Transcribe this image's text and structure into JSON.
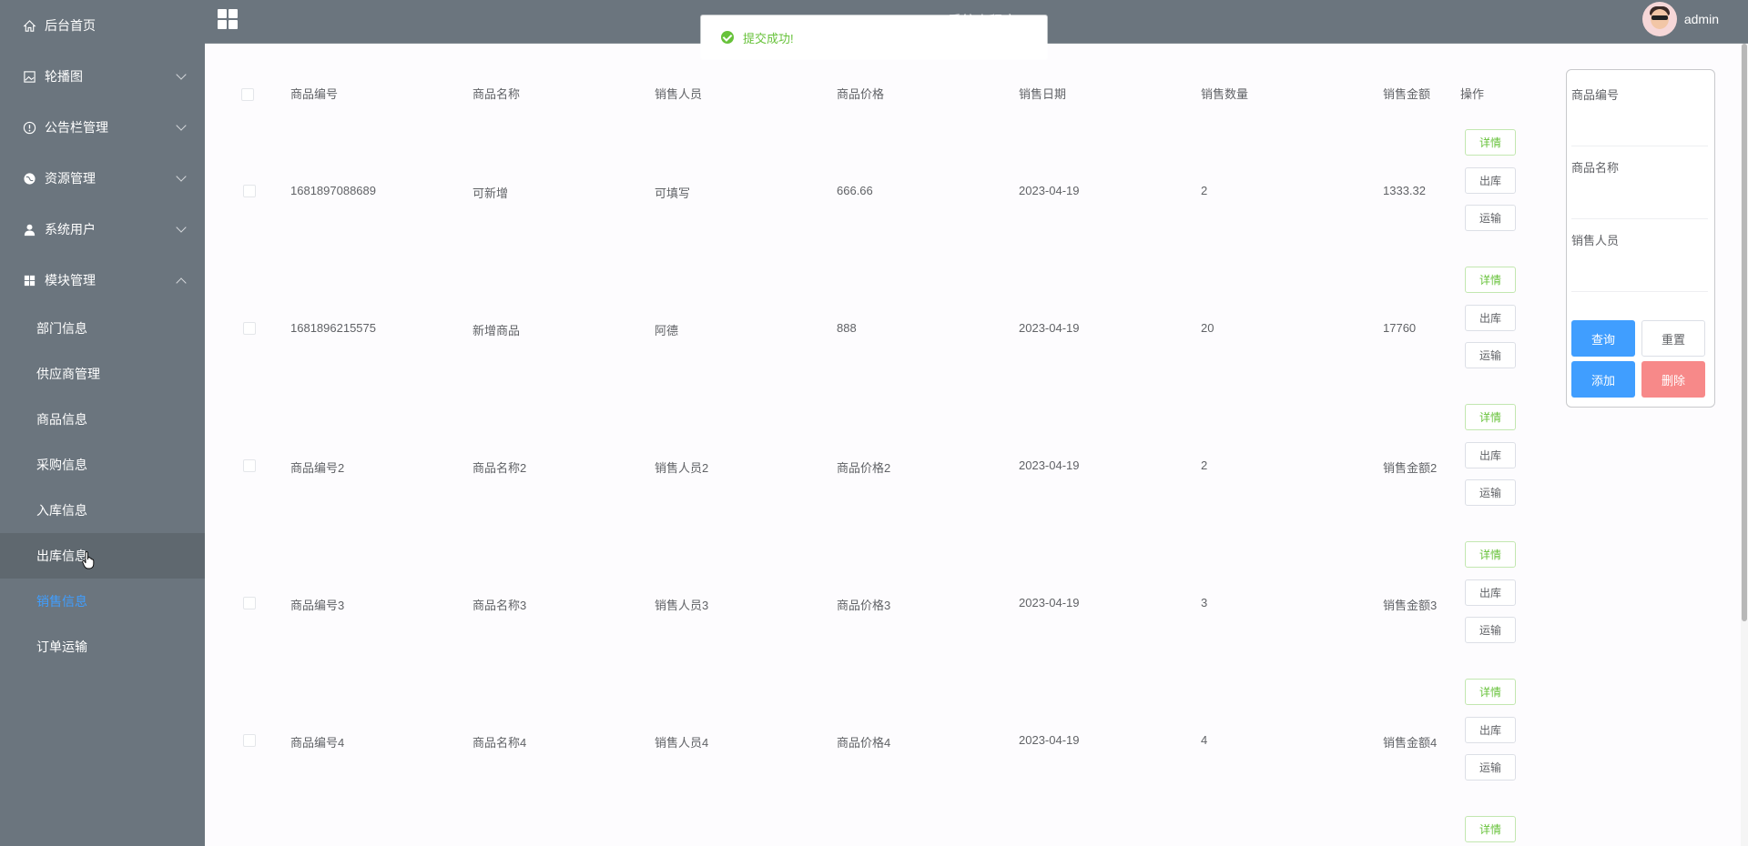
{
  "header": {
    "title": "...系统小程序",
    "user_name": "admin"
  },
  "toast": {
    "message": "提交成功!"
  },
  "sidebar": {
    "items": [
      {
        "label": "后台首页"
      },
      {
        "label": "轮播图"
      },
      {
        "label": "公告栏管理"
      },
      {
        "label": "资源管理"
      },
      {
        "label": "系统用户"
      },
      {
        "label": "模块管理"
      }
    ],
    "sub_items": [
      {
        "label": "部门信息"
      },
      {
        "label": "供应商管理"
      },
      {
        "label": "商品信息"
      },
      {
        "label": "采购信息"
      },
      {
        "label": "入库信息"
      },
      {
        "label": "出库信息"
      },
      {
        "label": "销售信息"
      },
      {
        "label": "订单运输"
      }
    ]
  },
  "table": {
    "columns": [
      "商品编号",
      "商品名称",
      "销售人员",
      "商品价格",
      "销售日期",
      "销售数量",
      "销售金额",
      "操作"
    ],
    "rows": [
      {
        "code": "1681897088689",
        "name": "可新增",
        "seller": "可填写",
        "price": "666.66",
        "date": "2023-04-19",
        "qty": "2",
        "amount": "1333.32"
      },
      {
        "code": "1681896215575",
        "name": "新增商品",
        "seller": "阿德",
        "price": "888",
        "date": "2023-04-19",
        "qty": "20",
        "amount": "17760"
      },
      {
        "code": "商品编号2",
        "name": "商品名称2",
        "seller": "销售人员2",
        "price": "商品价格2",
        "date": "2023-04-19",
        "qty": "2",
        "amount": "销售金额2"
      },
      {
        "code": "商品编号3",
        "name": "商品名称3",
        "seller": "销售人员3",
        "price": "商品价格3",
        "date": "2023-04-19",
        "qty": "3",
        "amount": "销售金额3"
      },
      {
        "code": "商品编号4",
        "name": "商品名称4",
        "seller": "销售人员4",
        "price": "商品价格4",
        "date": "2023-04-19",
        "qty": "4",
        "amount": "销售金额4"
      }
    ],
    "actions": {
      "detail": "详情",
      "out": "出库",
      "ship": "运输"
    }
  },
  "search": {
    "label_code": "商品编号",
    "label_name": "商品名称",
    "label_seller": "销售人员",
    "query": "查询",
    "reset": "重置",
    "add": "添加",
    "delete": "删除"
  },
  "colors": {
    "sidebar_bg": "#6b757e",
    "active": "#409eff",
    "success": "#67c23a",
    "danger": "#f78989"
  }
}
